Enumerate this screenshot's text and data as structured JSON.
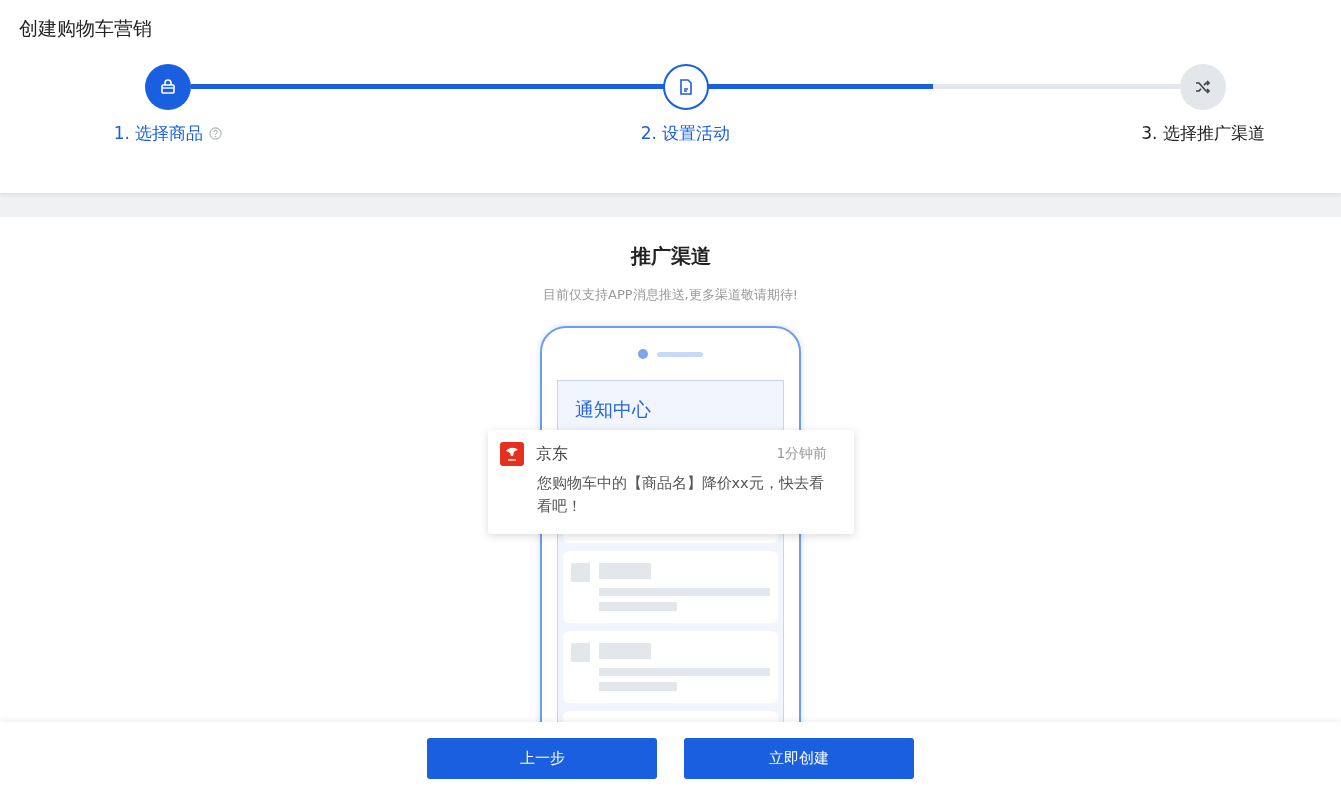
{
  "page_title": "创建购物车营销",
  "progress": {
    "level": 0.75
  },
  "steps": [
    {
      "label": "1. 选择商品",
      "done": true,
      "current": false,
      "help": true
    },
    {
      "label": "2. 设置活动",
      "done": false,
      "current": true,
      "help": false
    },
    {
      "label": "3. 选择推广渠道",
      "done": false,
      "current": false,
      "help": false
    }
  ],
  "section": {
    "title": "推广渠道",
    "subtitle": "目前仅支持APP消息推送,更多渠道敬请期待!"
  },
  "phone": {
    "screen_title": "通知中心"
  },
  "notification": {
    "app": "京东",
    "time": "1分钟前",
    "message": "您购物车中的【商品名】降价xx元，快去看看吧！"
  },
  "buttons": [
    {
      "label": "上一步"
    },
    {
      "label": "立即创建"
    }
  ]
}
